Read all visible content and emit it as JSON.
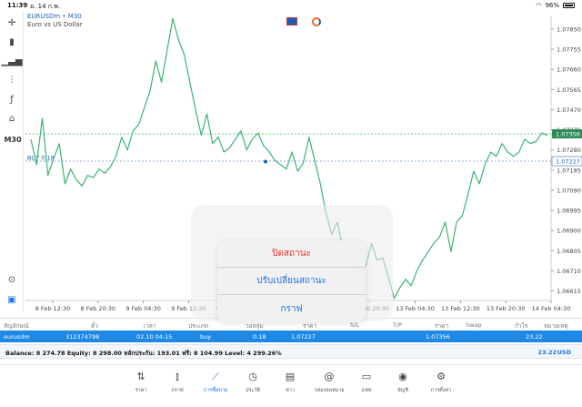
{
  "status": {
    "time": "11:39",
    "date": "อ. 14 ก.พ.",
    "battery": "96%"
  },
  "toolbar": {
    "timeframe": "M30"
  },
  "chart_header": {
    "symbol": "EURUSDm",
    "separator": "•",
    "timeframe": "M30",
    "description": "Euro vs US Dollar"
  },
  "chart_data": {
    "type": "line",
    "color": "#3cb371",
    "y_ticks": [
      "1.07850",
      "1.07755",
      "1.07660",
      "1.07565",
      "1.07470",
      "1.07375",
      "1.07280",
      "1.07185",
      "1.07090",
      "1.06995",
      "1.06900",
      "1.06805",
      "1.06710",
      "1.06615"
    ],
    "ylim": [
      1.0657,
      1.0791
    ],
    "x_ticks": [
      "8 Feb 12:30",
      "8 Feb 20:30",
      "9 Feb 04:30",
      "9 Feb 12:30",
      "9 Feb 20:30",
      "10 Feb 04:30",
      "10 Feb 12:30",
      "10 Feb 20:30",
      "13 Feb 04:30",
      "13 Feb 12:30",
      "13 Feb 20:30",
      "14 Feb 04:30"
    ],
    "ask_line": {
      "value": 1.07356,
      "label": "1.07356"
    },
    "buy_line": {
      "value": 1.07227,
      "label": "1.07227",
      "tag": "BUY 0.18"
    },
    "values": [
      1.0733,
      1.0721,
      1.0743,
      1.0716,
      1.0724,
      1.0731,
      1.0712,
      1.0719,
      1.0714,
      1.0711,
      1.0716,
      1.0715,
      1.0719,
      1.0717,
      1.072,
      1.0725,
      1.0734,
      1.0728,
      1.0737,
      1.074,
      1.0748,
      1.0756,
      1.077,
      1.076,
      1.0775,
      1.079,
      1.078,
      1.0773,
      1.076,
      1.0747,
      1.0735,
      1.0745,
      1.0731,
      1.0734,
      1.0727,
      1.0729,
      1.0733,
      1.0737,
      1.0728,
      1.0733,
      1.0736,
      1.073,
      1.0727,
      1.0723,
      1.0721,
      1.0719,
      1.0727,
      1.0718,
      1.0722,
      1.0734,
      1.0723,
      1.0712,
      1.0698,
      1.0688,
      1.0694,
      1.0681,
      1.068,
      1.0671,
      1.0683,
      1.0673,
      1.0684,
      1.0676,
      1.0677,
      1.0668,
      1.0658,
      1.0663,
      1.0667,
      1.0664,
      1.0671,
      1.0676,
      1.068,
      1.0684,
      1.0687,
      1.0694,
      1.068,
      1.0694,
      1.0697,
      1.0707,
      1.0718,
      1.0712,
      1.0721,
      1.0727,
      1.0725,
      1.0731,
      1.0727,
      1.0725,
      1.0727,
      1.0733,
      1.0731,
      1.0732,
      1.0736,
      1.0735
    ]
  },
  "context_menu": {
    "close": "ปิดสถานะ",
    "modify": "ปรับเปลี่ยนสถานะ",
    "chart": "กราฟ"
  },
  "table": {
    "headers": [
      "สัญลักษณ์",
      "ตั๋ว",
      "เวลา",
      "ประเภท",
      "วอลลุ่ม",
      "ราคา",
      "S/L",
      "T/P",
      "ราคา",
      "Swap",
      "กำไร",
      "หมายเหตุ"
    ],
    "row": {
      "symbol": "eurusdm",
      "ticket": "312374798",
      "time": "02.10 04:15",
      "type": "buy",
      "volume": "0.18",
      "open_price": "1.07227",
      "price": "1.07356",
      "profit": "23.22"
    }
  },
  "balance": {
    "text": "Balance: 8 274.78 Equity: 8 298.00 หลักประกัน: 193.01 ฟรี: 8 104.99 Level: 4 299.26%",
    "amount": "23.22",
    "currency": "USD"
  },
  "nav": [
    {
      "label": "ราคา",
      "icon": "quotes-icon"
    },
    {
      "label": "กราฟ",
      "icon": "chart-icon"
    },
    {
      "label": "การซื้อขาย",
      "icon": "trade-icon"
    },
    {
      "label": "ประวัติ",
      "icon": "history-icon"
    },
    {
      "label": "ข่าว",
      "icon": "news-icon"
    },
    {
      "label": "กล่องจดหมาย",
      "icon": "mailbox-icon"
    },
    {
      "label": "แชท",
      "icon": "chat-icon"
    },
    {
      "label": "บัญชี",
      "icon": "account-icon"
    },
    {
      "label": "การตั้งค่า",
      "icon": "settings-icon"
    }
  ],
  "colors": {
    "accent": "#1a73e8",
    "row_highlight": "#1e88e5",
    "line": "#3cb371",
    "danger": "#e0352b"
  }
}
